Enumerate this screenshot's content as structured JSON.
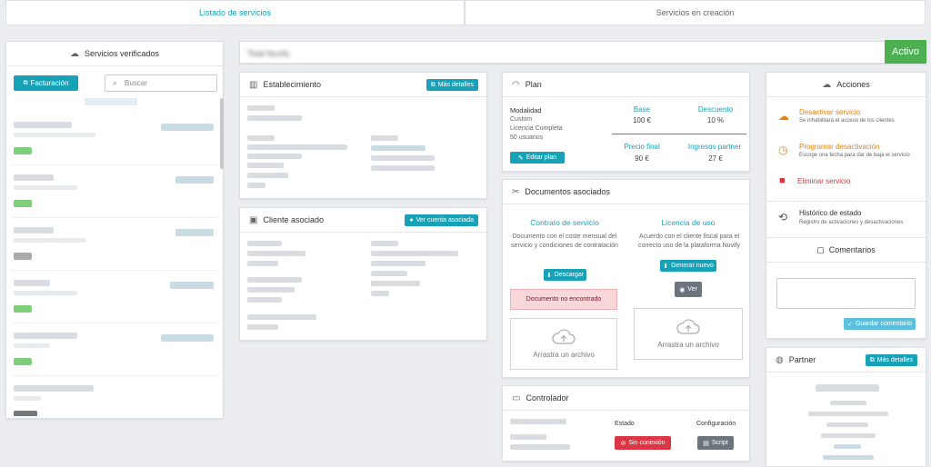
{
  "tabs": {
    "list": "Listado de servicios",
    "creating": "Servicios en creación"
  },
  "left": {
    "title": "Servicios verificados",
    "billing_button": "Facturación",
    "search_placeholder": "Buscar"
  },
  "service": {
    "name": "Total Nuvify",
    "status": "Activo"
  },
  "establishment": {
    "title": "Establecimiento",
    "details_button": "Más detalles"
  },
  "client": {
    "title": "Cliente asociado",
    "account_button": "Ver cuenta asociada"
  },
  "plan": {
    "title": "Plan",
    "modality_label": "Modalidad",
    "modality_lines": [
      "Custom",
      "Licencia Completa",
      "50 usuarios"
    ],
    "edit_button": "Editar plan",
    "base_label": "Base",
    "base_value": "100 €",
    "discount_label": "Descuento",
    "discount_value": "10 %",
    "final_label": "Precio final",
    "final_value": "90 €",
    "partner_label": "Ingresos partner",
    "partner_value": "27 €"
  },
  "documents": {
    "title": "Documentos asociados",
    "contract": {
      "title": "Contrato de servicio",
      "desc": "Documento con el coste mensual del servicio y condiciones de contratación",
      "download": "Descargar",
      "not_found": "Documento no encontrado",
      "drop": "Arrastra un archivo"
    },
    "license": {
      "title": "Licencia de uso",
      "desc": "Acuerdo con el cliente fiscal para el correcto uso de la plataforma Nuvify",
      "generate": "Generar nuevo",
      "view": "Ver",
      "drop": "Arrastra un archivo"
    }
  },
  "controller": {
    "title": "Controlador",
    "state_label": "Estado",
    "state_value": "Sin conexión",
    "config_label": "Configuración",
    "script_button": "Script"
  },
  "actions": {
    "title": "Acciones",
    "items": [
      {
        "label": "Desactivar servicio",
        "desc": "Se inhabilitará el acceso de los clientes"
      },
      {
        "label": "Programar desactivación",
        "desc": "Escoge una fecha para dar de baja el servicio"
      },
      {
        "label": "Eliminar servicio",
        "desc": ""
      },
      {
        "label": "Histórico de estado",
        "desc": "Registro de activaciones y desactivaciones"
      }
    ],
    "comments_title": "Comentarios",
    "save_comment": "Guardar comentario"
  },
  "partner": {
    "title": "Partner",
    "details_button": "Más detalles"
  },
  "colors": {
    "accent": "#17a2b8",
    "active": "#4caf50",
    "orange": "#e8820e",
    "red": "#d9363e"
  }
}
